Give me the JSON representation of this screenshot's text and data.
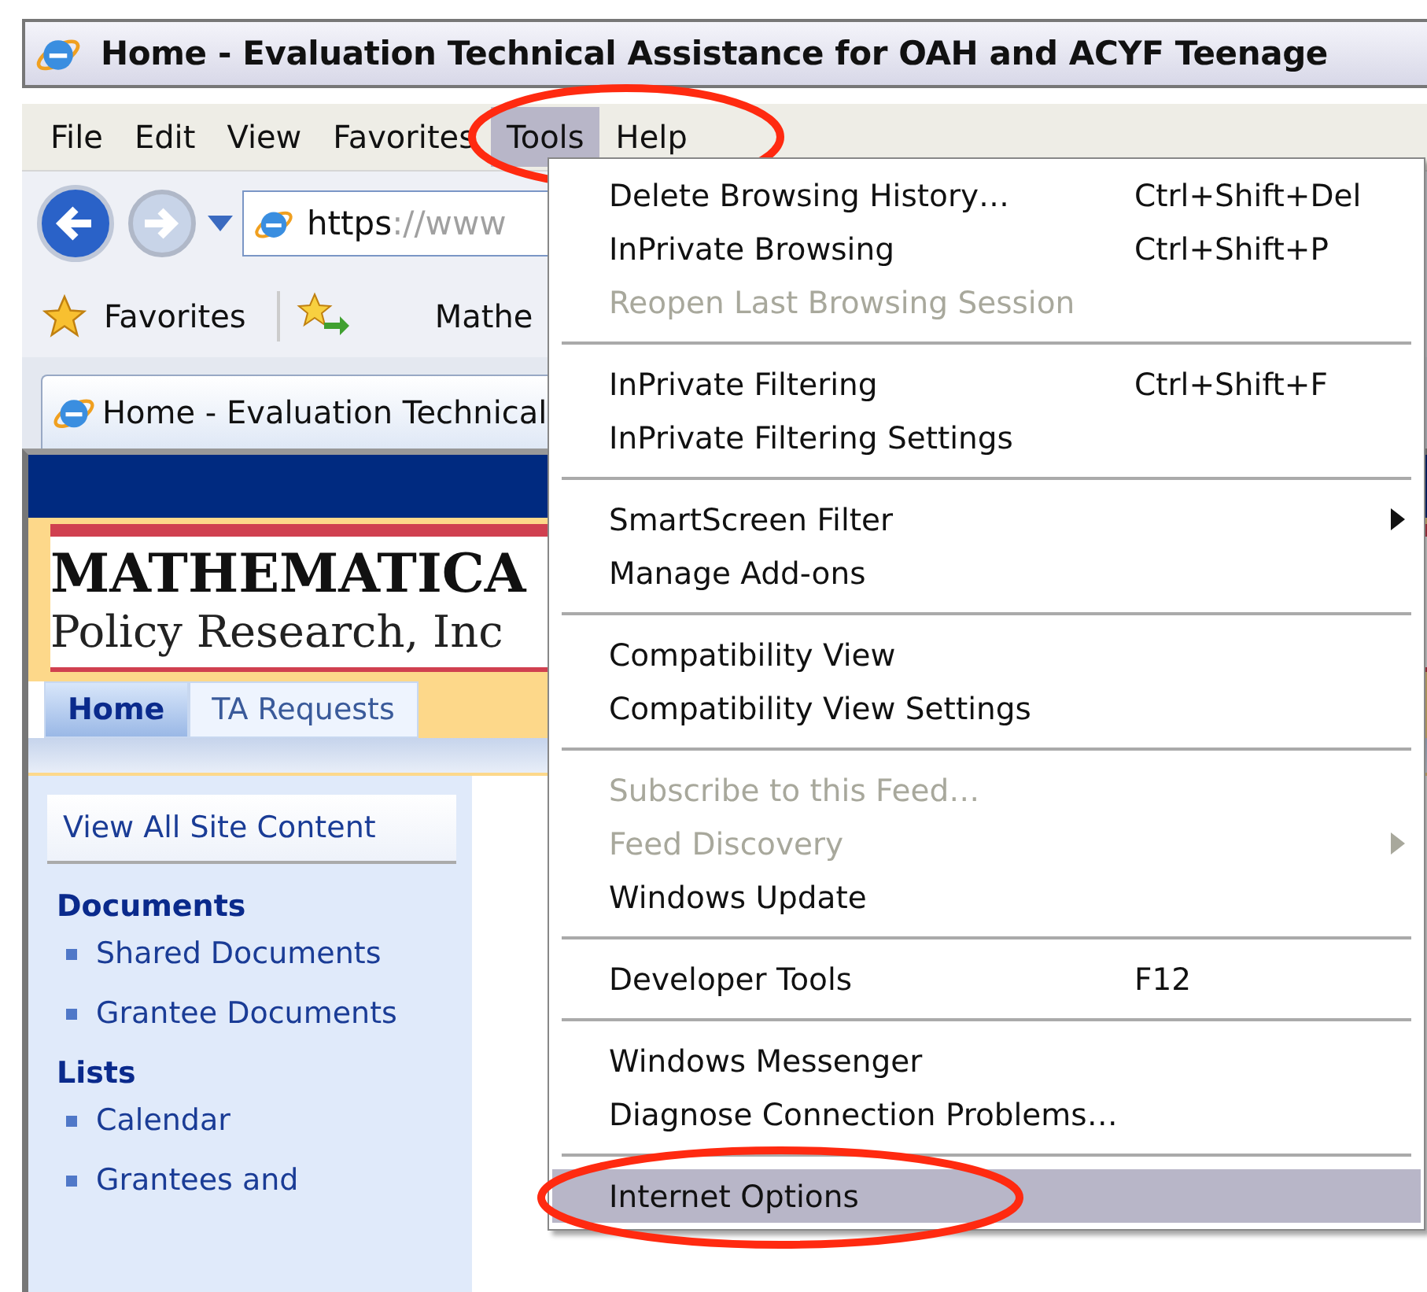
{
  "window": {
    "title": "Home - Evaluation Technical Assistance for OAH and ACYF Teenage"
  },
  "menu_bar": [
    {
      "label": "File",
      "selected": false
    },
    {
      "label": "Edit",
      "selected": false
    },
    {
      "label": "View",
      "selected": false
    },
    {
      "label": "Favorites",
      "selected": false
    },
    {
      "label": "Tools",
      "selected": true
    },
    {
      "label": "Help",
      "selected": false
    }
  ],
  "address": {
    "scheme": "https",
    "rest": "://www"
  },
  "favorites_bar": {
    "label": "Favorites",
    "link": "Mathe"
  },
  "browser_tab": {
    "title": "Home - Evaluation Technical"
  },
  "page": {
    "logo": {
      "name": "MATHEMATICA",
      "subtitle": "Policy Research, Inc"
    },
    "nav_tabs": [
      {
        "label": "Home",
        "selected": true
      },
      {
        "label": "TA Requests",
        "selected": false
      }
    ],
    "quick_launch": {
      "view_all": "View All Site Content",
      "sections": [
        {
          "heading": "Documents",
          "items": [
            "Shared Documents",
            "Grantee Documents"
          ]
        },
        {
          "heading": "Lists",
          "items": [
            "Calendar",
            "Grantees and"
          ]
        }
      ]
    }
  },
  "tools_menu": [
    [
      {
        "label": "Delete Browsing History…",
        "shortcut": "Ctrl+Shift+Del",
        "disabled": false,
        "submenu": false,
        "selected": false
      },
      {
        "label": "InPrivate Browsing",
        "shortcut": "Ctrl+Shift+P",
        "disabled": false,
        "submenu": false,
        "selected": false
      },
      {
        "label": "Reopen Last Browsing Session",
        "disabled": true,
        "submenu": false,
        "selected": false
      }
    ],
    [
      {
        "label": "InPrivate Filtering",
        "shortcut": "Ctrl+Shift+F",
        "disabled": false,
        "submenu": false,
        "selected": false
      },
      {
        "label": "InPrivate Filtering Settings",
        "disabled": false,
        "submenu": false,
        "selected": false
      }
    ],
    [
      {
        "label": "SmartScreen Filter",
        "disabled": false,
        "submenu": true,
        "selected": false
      },
      {
        "label": "Manage Add-ons",
        "disabled": false,
        "submenu": false,
        "selected": false
      }
    ],
    [
      {
        "label": "Compatibility View",
        "disabled": false,
        "submenu": false,
        "selected": false
      },
      {
        "label": "Compatibility View Settings",
        "disabled": false,
        "submenu": false,
        "selected": false
      }
    ],
    [
      {
        "label": "Subscribe to this Feed…",
        "disabled": true,
        "submenu": false,
        "selected": false
      },
      {
        "label": "Feed Discovery",
        "disabled": true,
        "submenu": true,
        "selected": false
      },
      {
        "label": "Windows Update",
        "disabled": false,
        "submenu": false,
        "selected": false
      }
    ],
    [
      {
        "label": "Developer Tools",
        "shortcut": "F12",
        "disabled": false,
        "submenu": false,
        "selected": false
      }
    ],
    [
      {
        "label": "Windows Messenger",
        "disabled": false,
        "submenu": false,
        "selected": false
      },
      {
        "label": "Diagnose Connection Problems…",
        "disabled": false,
        "submenu": false,
        "selected": false
      }
    ],
    [
      {
        "label": "Internet Options",
        "disabled": false,
        "submenu": false,
        "selected": true
      }
    ]
  ]
}
